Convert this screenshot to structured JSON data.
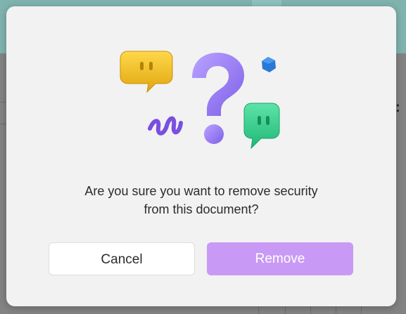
{
  "dialog": {
    "message_line1": "Are you sure you want to remove security",
    "message_line2": "from this document?",
    "cancel_label": "Cancel",
    "remove_label": "Remove"
  },
  "colors": {
    "remove_button": "#c99af5",
    "question_mark": "#9a7cf2",
    "yellow_bubble": "#f2c12e",
    "green_bubble": "#2fd08c",
    "blue_gem": "#2a78d6",
    "squiggle": "#7a4fe0"
  },
  "illustration": {
    "icons": [
      "yellow-chat-bubble-icon",
      "question-mark-icon",
      "green-chat-bubble-icon",
      "blue-gem-icon",
      "squiggle-icon"
    ]
  }
}
